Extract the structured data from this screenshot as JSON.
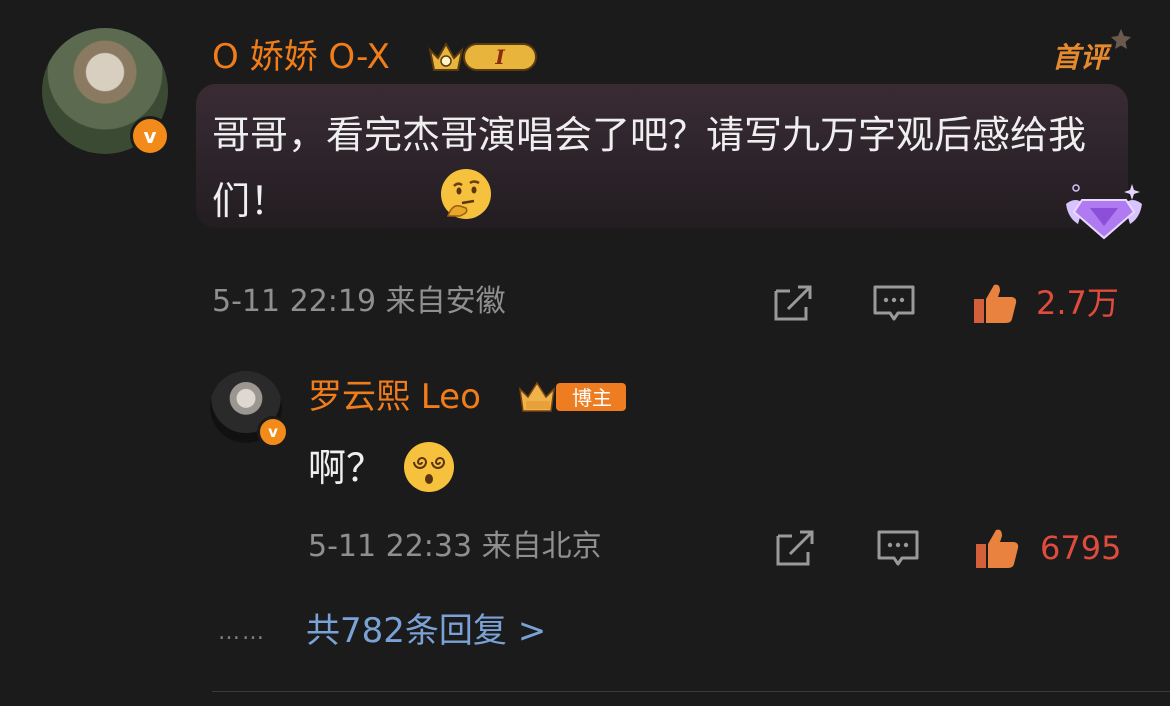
{
  "comment": {
    "username": "O 娇娇 O-X",
    "badge_level": "I",
    "first_badge": "首评",
    "text": "哥哥，看完杰哥演唱会了吧？请写九万字观后感给我们！",
    "time": "5-11 22:19",
    "location": "来自安徽",
    "likes": "2.7万",
    "verified_mark": "v"
  },
  "reply": {
    "username": "罗云熙 Leo",
    "badge_label": "博主",
    "text": "啊？",
    "time": "5-11 22:33",
    "location": "来自北京",
    "likes": "6795",
    "verified_mark": "v"
  },
  "more_replies": {
    "dots": "……",
    "label": "共782条回复 >"
  },
  "colors": {
    "background": "#1b1b1b",
    "username": "#f07d1a",
    "like_count": "#e04b3e",
    "link": "#7aa2d6",
    "meta": "#8f8f8f"
  },
  "icons": [
    "share-icon",
    "comment-icon",
    "like-icon",
    "thinking-face-emoji",
    "dizzy-face-emoji",
    "gem-icon",
    "crown-icon"
  ]
}
